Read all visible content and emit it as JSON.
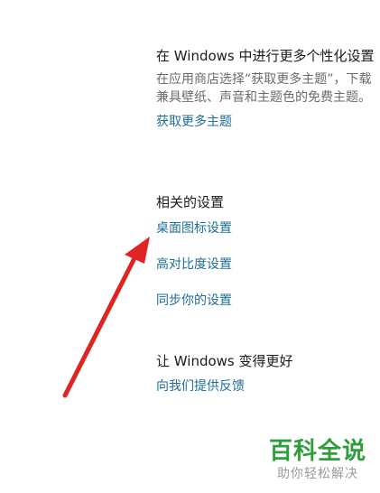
{
  "personalize": {
    "title": "在 Windows 中进行更多个性化设置",
    "description": "在应用商店选择“获取更多主题”，下载兼具壁纸、声音和主题色的免费主题。",
    "link": "获取更多主题"
  },
  "related": {
    "title": "相关的设置",
    "links": [
      "桌面图标设置",
      "高对比度设置",
      "同步你的设置"
    ]
  },
  "better": {
    "title": "让 Windows 变得更好",
    "link": "向我们提供反馈"
  },
  "watermark": {
    "main": "百科全说",
    "sub": "助你轻松解决"
  },
  "colors": {
    "link": "#1f6e95",
    "arrow": "#e02424",
    "watermark": "#2e9e3c"
  }
}
